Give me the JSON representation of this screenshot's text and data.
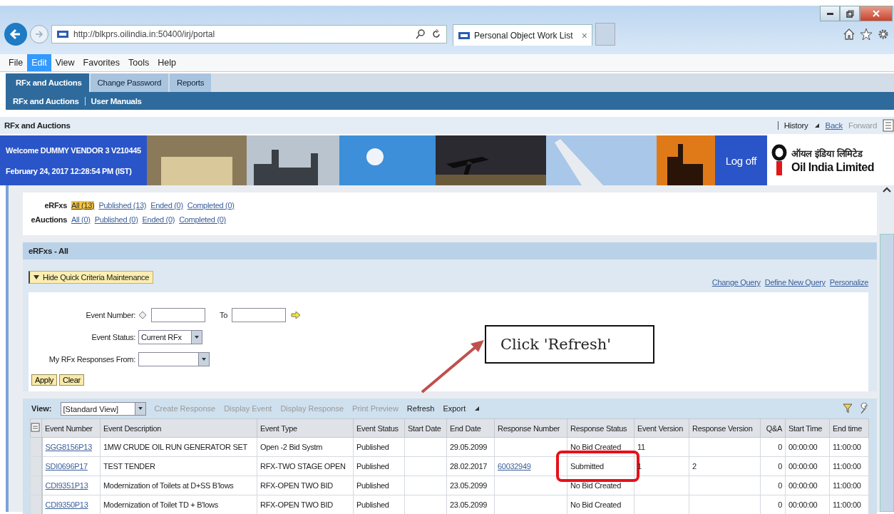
{
  "browser": {
    "url": "http://blkprs.oilindia.in:50400/irj/portal",
    "tab_title": "Personal Object Work List",
    "tab_close": "×",
    "menu": [
      {
        "label": "File",
        "selected": false
      },
      {
        "label": "Edit",
        "selected": true
      },
      {
        "label": "View",
        "selected": false
      },
      {
        "label": "Favorites",
        "selected": false
      },
      {
        "label": "Tools",
        "selected": false
      },
      {
        "label": "Help",
        "selected": false
      }
    ]
  },
  "portal": {
    "top_nav": [
      {
        "label": "RFx and Auctions",
        "selected": true
      },
      {
        "label": "Change Password",
        "selected": false
      },
      {
        "label": "Reports",
        "selected": false
      }
    ],
    "sub_nav": [
      "RFx and Auctions",
      "User Manuals"
    ],
    "page_title": "RFx and Auctions",
    "history": [
      {
        "label": "History",
        "kind": "menu"
      },
      {
        "label": "Back",
        "kind": "link"
      },
      {
        "label": "Forward",
        "kind": "disabled"
      }
    ]
  },
  "banner": {
    "welcome": "Welcome DUMMY VENDOR 3 V210445",
    "datetime": "February 24, 2017  12:28:54 PM (IST)",
    "logoff": "Log off",
    "logo_hindi": "ऑयल इंडिया लिमिटेड",
    "logo_english": "Oil India Limited"
  },
  "filters": [
    {
      "label": "eRFxs",
      "links": [
        {
          "label": "All (13)",
          "selected": true
        },
        {
          "label": "Published (13)",
          "selected": false
        },
        {
          "label": "Ended (0)",
          "selected": false
        },
        {
          "label": "Completed (0)",
          "selected": false
        }
      ]
    },
    {
      "label": "eAuctions",
      "links": [
        {
          "label": "All (0)",
          "selected": false
        },
        {
          "label": "Published (0)",
          "selected": false
        },
        {
          "label": "Ended (0)",
          "selected": false
        },
        {
          "label": "Completed (0)",
          "selected": false
        }
      ]
    }
  ],
  "section_title": "eRFxs - All",
  "criteria": {
    "toggle": "Hide Quick Criteria Maintenance",
    "links": [
      "Change Query",
      "Define New Query",
      "Personalize"
    ],
    "event_number_label": "Event Number:",
    "to_label": "To",
    "event_status_label": "Event Status:",
    "event_status_value": "Current RFx",
    "responses_label": "My RFx Responses From:",
    "buttons": [
      "Apply",
      "Clear"
    ]
  },
  "toolbar": {
    "view_label": "View:",
    "view_value": "[Standard View]",
    "actions": [
      {
        "label": "Create Response",
        "kind": "disabled"
      },
      {
        "label": "Display Event",
        "kind": "disabled"
      },
      {
        "label": "Display Response",
        "kind": "disabled"
      },
      {
        "label": "Print Preview",
        "kind": "disabled"
      },
      {
        "label": "Refresh",
        "kind": "button"
      },
      {
        "label": "Export",
        "kind": "menu"
      }
    ]
  },
  "table": {
    "columns": [
      "Event Number",
      "Event Description",
      "Event Type",
      "Event Status",
      "Start Date",
      "End Date",
      "Response Number",
      "Response Status",
      "Event Version",
      "Response Version",
      "Q&A",
      "Start Time",
      "End time"
    ],
    "rows": [
      {
        "event_number": "SGG8156P13",
        "description": "1MW CRUDE OIL RUN GENERATOR SET",
        "type": "Open -2 Bid Systm",
        "status": "Published",
        "end_date": "29.05.2099",
        "response_status": "No Bid Created",
        "event_version": "11",
        "qa": "0",
        "start_time": "00:00:00",
        "end_time": "11:00:00",
        "highlighted": false
      },
      {
        "event_number": "SDI0696P17",
        "description": "TEST TENDER",
        "type": "RFX-TWO STAGE OPEN",
        "status": "Published",
        "end_date": "28.02.2017",
        "response_number": "60032949",
        "response_status": "Submitted",
        "event_version": "1",
        "response_version": "2",
        "qa": "0",
        "start_time": "00:00:00",
        "end_time": "11:00:00",
        "highlighted": true
      },
      {
        "event_number": "CDI9351P13",
        "description": "Modernization of Toilets at D+SS B'lows",
        "type": "RFX-OPEN TWO BID",
        "status": "Published",
        "end_date": "23.05.2099",
        "response_status": "No Bid Created",
        "qa": "0",
        "start_time": "00:00:00",
        "end_time": "11:00:00",
        "highlighted": false
      },
      {
        "event_number": "CDI9350P13",
        "description": "Modernization of Toilet TD + B'lows",
        "type": "RFX-OPEN TWO BID",
        "status": "Published",
        "end_date": "23.05.2099",
        "response_status": "No Bid Created",
        "qa": "0",
        "start_time": "00:00:00",
        "end_time": "11:00:00",
        "highlighted": false
      }
    ]
  },
  "annotation": {
    "callout": "Click 'Refresh'"
  }
}
